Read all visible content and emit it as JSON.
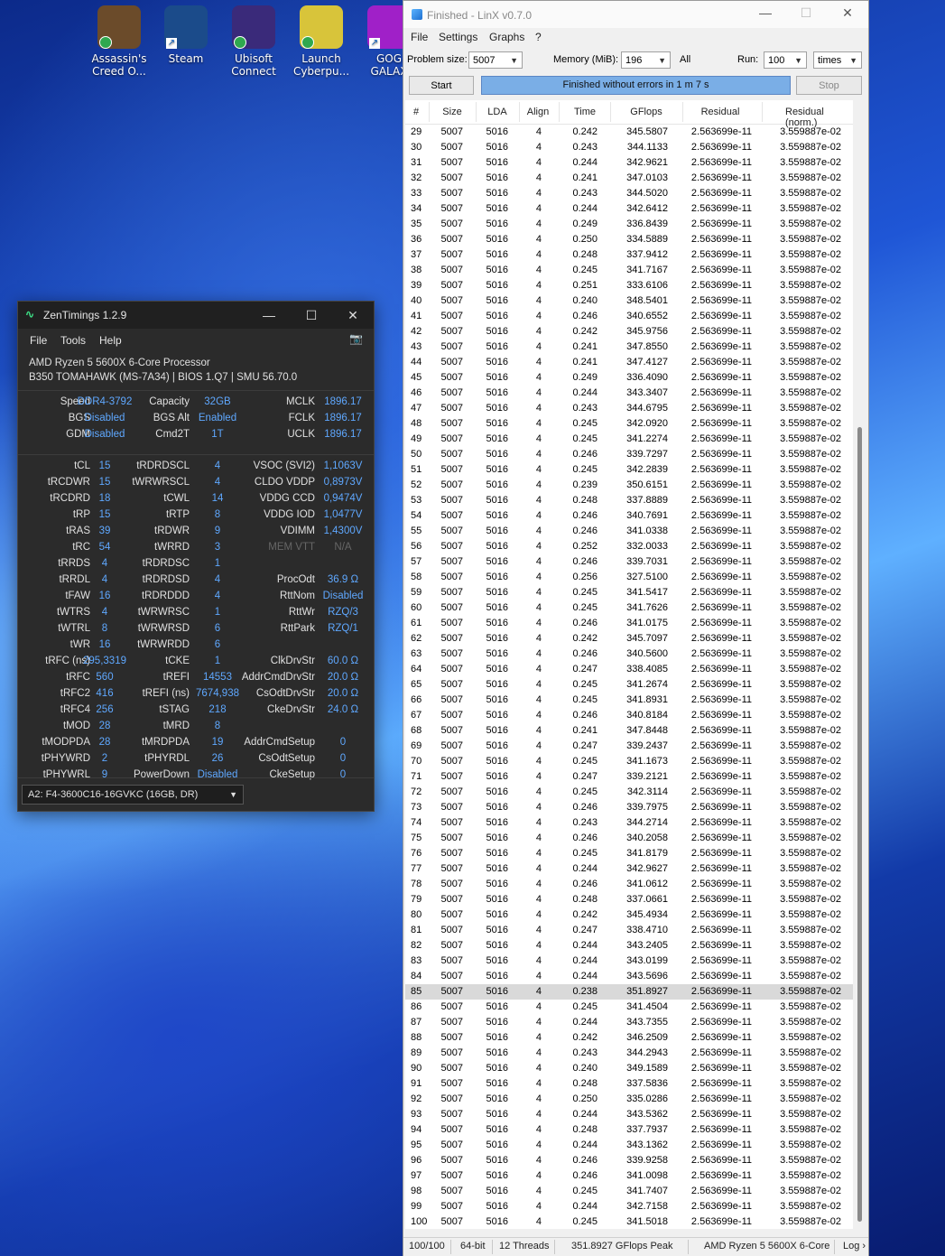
{
  "desktop": {
    "icons": [
      {
        "label": "Assassin's Creed O...",
        "color": "#6b4b2a",
        "badge": "check"
      },
      {
        "label": "Steam",
        "color": "#1b4b8a",
        "badge": "link"
      },
      {
        "label": "Ubisoft Connect",
        "color": "#3a2a7a",
        "badge": "check"
      },
      {
        "label": "Launch Cyberpu...",
        "color": "#d8c43a",
        "badge": "check"
      },
      {
        "label": "GOG GALAX",
        "color": "#a020c8",
        "badge": "link"
      }
    ]
  },
  "zentimings": {
    "title": "ZenTimings 1.2.9",
    "menu": [
      "File",
      "Tools",
      "Help"
    ],
    "cpu": "AMD Ryzen 5 5600X 6-Core Processor",
    "board": "B350 TOMAHAWK (MS-7A34) | BIOS 1.Q7 | SMU 56.70.0",
    "rows1": [
      [
        "Speed",
        "DDR4-3792",
        "Capacity",
        "32GB",
        "MCLK",
        "1896.17"
      ],
      [
        "BGS",
        "Disabled",
        "BGS Alt",
        "Enabled",
        "FCLK",
        "1896.17"
      ],
      [
        "GDM",
        "Disabled",
        "Cmd2T",
        "1T",
        "UCLK",
        "1896.17"
      ]
    ],
    "rows2": [
      [
        "tCL",
        "15",
        "tRDRDSCL",
        "4",
        "VSOC (SVI2)",
        "1,1063V"
      ],
      [
        "tRCDWR",
        "15",
        "tWRWRSCL",
        "4",
        "CLDO VDDP",
        "0,8973V"
      ],
      [
        "tRCDRD",
        "18",
        "tCWL",
        "14",
        "VDDG CCD",
        "0,9474V"
      ],
      [
        "tRP",
        "15",
        "tRTP",
        "8",
        "VDDG IOD",
        "1,0477V"
      ],
      [
        "tRAS",
        "39",
        "tRDWR",
        "9",
        "VDIMM",
        "1,4300V"
      ],
      [
        "tRC",
        "54",
        "tWRRD",
        "3",
        "MEM VTT",
        "N/A"
      ],
      [
        "tRRDS",
        "4",
        "tRDRDSC",
        "1",
        "",
        ""
      ],
      [
        "tRRDL",
        "4",
        "tRDRDSD",
        "4",
        "ProcOdt",
        "36.9 Ω"
      ],
      [
        "tFAW",
        "16",
        "tRDRDDD",
        "4",
        "RttNom",
        "Disabled"
      ],
      [
        "tWTRS",
        "4",
        "tWRWRSC",
        "1",
        "RttWr",
        "RZQ/3"
      ],
      [
        "tWTRL",
        "8",
        "tWRWRSD",
        "6",
        "RttPark",
        "RZQ/1"
      ],
      [
        "tWR",
        "16",
        "tWRWRDD",
        "6",
        "",
        ""
      ],
      [
        "tRFC (ns)",
        "295,3319",
        "tCKE",
        "1",
        "ClkDrvStr",
        "60.0 Ω"
      ],
      [
        "tRFC",
        "560",
        "tREFI",
        "14553",
        "AddrCmdDrvStr",
        "20.0 Ω"
      ],
      [
        "tRFC2",
        "416",
        "tREFI (ns)",
        "7674,938",
        "CsOdtDrvStr",
        "20.0 Ω"
      ],
      [
        "tRFC4",
        "256",
        "tSTAG",
        "218",
        "CkeDrvStr",
        "24.0 Ω"
      ],
      [
        "tMOD",
        "28",
        "tMRD",
        "8",
        "",
        ""
      ],
      [
        "tMODPDA",
        "28",
        "tMRDPDA",
        "19",
        "AddrCmdSetup",
        "0"
      ],
      [
        "tPHYWRD",
        "2",
        "tPHYRDL",
        "26",
        "CsOdtSetup",
        "0"
      ],
      [
        "tPHYWRL",
        "9",
        "PowerDown",
        "Disabled",
        "CkeSetup",
        "0"
      ]
    ],
    "module": "A2: F4-3600C16-16GVKC (16GB, DR)"
  },
  "linx": {
    "title": "Finished - LinX v0.7.0",
    "menu": [
      "File",
      "Settings",
      "Graphs",
      "?"
    ],
    "problem_size_label": "Problem size:",
    "problem_size": "5007",
    "memory_label": "Memory (MiB):",
    "memory": "196",
    "all_label": "All",
    "run_label": "Run:",
    "run": "100",
    "run_unit": "times",
    "start": "Start",
    "progress_text": "Finished without errors in 1 m 7 s",
    "progress_value": 1.0,
    "stop": "Stop",
    "columns": [
      "#",
      "Size",
      "LDA",
      "Align",
      "Time",
      "GFlops",
      "Residual",
      "Residual (norm.)"
    ],
    "rows": [
      [
        "29",
        "5007",
        "5016",
        "4",
        "0.242",
        "345.5807",
        "2.563699e-11",
        "3.559887e-02"
      ],
      [
        "30",
        "5007",
        "5016",
        "4",
        "0.243",
        "344.1133",
        "2.563699e-11",
        "3.559887e-02"
      ],
      [
        "31",
        "5007",
        "5016",
        "4",
        "0.244",
        "342.9621",
        "2.563699e-11",
        "3.559887e-02"
      ],
      [
        "32",
        "5007",
        "5016",
        "4",
        "0.241",
        "347.0103",
        "2.563699e-11",
        "3.559887e-02"
      ],
      [
        "33",
        "5007",
        "5016",
        "4",
        "0.243",
        "344.5020",
        "2.563699e-11",
        "3.559887e-02"
      ],
      [
        "34",
        "5007",
        "5016",
        "4",
        "0.244",
        "342.6412",
        "2.563699e-11",
        "3.559887e-02"
      ],
      [
        "35",
        "5007",
        "5016",
        "4",
        "0.249",
        "336.8439",
        "2.563699e-11",
        "3.559887e-02"
      ],
      [
        "36",
        "5007",
        "5016",
        "4",
        "0.250",
        "334.5889",
        "2.563699e-11",
        "3.559887e-02"
      ],
      [
        "37",
        "5007",
        "5016",
        "4",
        "0.248",
        "337.9412",
        "2.563699e-11",
        "3.559887e-02"
      ],
      [
        "38",
        "5007",
        "5016",
        "4",
        "0.245",
        "341.7167",
        "2.563699e-11",
        "3.559887e-02"
      ],
      [
        "39",
        "5007",
        "5016",
        "4",
        "0.251",
        "333.6106",
        "2.563699e-11",
        "3.559887e-02"
      ],
      [
        "40",
        "5007",
        "5016",
        "4",
        "0.240",
        "348.5401",
        "2.563699e-11",
        "3.559887e-02"
      ],
      [
        "41",
        "5007",
        "5016",
        "4",
        "0.246",
        "340.6552",
        "2.563699e-11",
        "3.559887e-02"
      ],
      [
        "42",
        "5007",
        "5016",
        "4",
        "0.242",
        "345.9756",
        "2.563699e-11",
        "3.559887e-02"
      ],
      [
        "43",
        "5007",
        "5016",
        "4",
        "0.241",
        "347.8550",
        "2.563699e-11",
        "3.559887e-02"
      ],
      [
        "44",
        "5007",
        "5016",
        "4",
        "0.241",
        "347.4127",
        "2.563699e-11",
        "3.559887e-02"
      ],
      [
        "45",
        "5007",
        "5016",
        "4",
        "0.249",
        "336.4090",
        "2.563699e-11",
        "3.559887e-02"
      ],
      [
        "46",
        "5007",
        "5016",
        "4",
        "0.244",
        "343.3407",
        "2.563699e-11",
        "3.559887e-02"
      ],
      [
        "47",
        "5007",
        "5016",
        "4",
        "0.243",
        "344.6795",
        "2.563699e-11",
        "3.559887e-02"
      ],
      [
        "48",
        "5007",
        "5016",
        "4",
        "0.245",
        "342.0920",
        "2.563699e-11",
        "3.559887e-02"
      ],
      [
        "49",
        "5007",
        "5016",
        "4",
        "0.245",
        "341.2274",
        "2.563699e-11",
        "3.559887e-02"
      ],
      [
        "50",
        "5007",
        "5016",
        "4",
        "0.246",
        "339.7297",
        "2.563699e-11",
        "3.559887e-02"
      ],
      [
        "51",
        "5007",
        "5016",
        "4",
        "0.245",
        "342.2839",
        "2.563699e-11",
        "3.559887e-02"
      ],
      [
        "52",
        "5007",
        "5016",
        "4",
        "0.239",
        "350.6151",
        "2.563699e-11",
        "3.559887e-02"
      ],
      [
        "53",
        "5007",
        "5016",
        "4",
        "0.248",
        "337.8889",
        "2.563699e-11",
        "3.559887e-02"
      ],
      [
        "54",
        "5007",
        "5016",
        "4",
        "0.246",
        "340.7691",
        "2.563699e-11",
        "3.559887e-02"
      ],
      [
        "55",
        "5007",
        "5016",
        "4",
        "0.246",
        "341.0338",
        "2.563699e-11",
        "3.559887e-02"
      ],
      [
        "56",
        "5007",
        "5016",
        "4",
        "0.252",
        "332.0033",
        "2.563699e-11",
        "3.559887e-02"
      ],
      [
        "57",
        "5007",
        "5016",
        "4",
        "0.246",
        "339.7031",
        "2.563699e-11",
        "3.559887e-02"
      ],
      [
        "58",
        "5007",
        "5016",
        "4",
        "0.256",
        "327.5100",
        "2.563699e-11",
        "3.559887e-02"
      ],
      [
        "59",
        "5007",
        "5016",
        "4",
        "0.245",
        "341.5417",
        "2.563699e-11",
        "3.559887e-02"
      ],
      [
        "60",
        "5007",
        "5016",
        "4",
        "0.245",
        "341.7626",
        "2.563699e-11",
        "3.559887e-02"
      ],
      [
        "61",
        "5007",
        "5016",
        "4",
        "0.246",
        "341.0175",
        "2.563699e-11",
        "3.559887e-02"
      ],
      [
        "62",
        "5007",
        "5016",
        "4",
        "0.242",
        "345.7097",
        "2.563699e-11",
        "3.559887e-02"
      ],
      [
        "63",
        "5007",
        "5016",
        "4",
        "0.246",
        "340.5600",
        "2.563699e-11",
        "3.559887e-02"
      ],
      [
        "64",
        "5007",
        "5016",
        "4",
        "0.247",
        "338.4085",
        "2.563699e-11",
        "3.559887e-02"
      ],
      [
        "65",
        "5007",
        "5016",
        "4",
        "0.245",
        "341.2674",
        "2.563699e-11",
        "3.559887e-02"
      ],
      [
        "66",
        "5007",
        "5016",
        "4",
        "0.245",
        "341.8931",
        "2.563699e-11",
        "3.559887e-02"
      ],
      [
        "67",
        "5007",
        "5016",
        "4",
        "0.246",
        "340.8184",
        "2.563699e-11",
        "3.559887e-02"
      ],
      [
        "68",
        "5007",
        "5016",
        "4",
        "0.241",
        "347.8448",
        "2.563699e-11",
        "3.559887e-02"
      ],
      [
        "69",
        "5007",
        "5016",
        "4",
        "0.247",
        "339.2437",
        "2.563699e-11",
        "3.559887e-02"
      ],
      [
        "70",
        "5007",
        "5016",
        "4",
        "0.245",
        "341.1673",
        "2.563699e-11",
        "3.559887e-02"
      ],
      [
        "71",
        "5007",
        "5016",
        "4",
        "0.247",
        "339.2121",
        "2.563699e-11",
        "3.559887e-02"
      ],
      [
        "72",
        "5007",
        "5016",
        "4",
        "0.245",
        "342.3114",
        "2.563699e-11",
        "3.559887e-02"
      ],
      [
        "73",
        "5007",
        "5016",
        "4",
        "0.246",
        "339.7975",
        "2.563699e-11",
        "3.559887e-02"
      ],
      [
        "74",
        "5007",
        "5016",
        "4",
        "0.243",
        "344.2714",
        "2.563699e-11",
        "3.559887e-02"
      ],
      [
        "75",
        "5007",
        "5016",
        "4",
        "0.246",
        "340.2058",
        "2.563699e-11",
        "3.559887e-02"
      ],
      [
        "76",
        "5007",
        "5016",
        "4",
        "0.245",
        "341.8179",
        "2.563699e-11",
        "3.559887e-02"
      ],
      [
        "77",
        "5007",
        "5016",
        "4",
        "0.244",
        "342.9627",
        "2.563699e-11",
        "3.559887e-02"
      ],
      [
        "78",
        "5007",
        "5016",
        "4",
        "0.246",
        "341.0612",
        "2.563699e-11",
        "3.559887e-02"
      ],
      [
        "79",
        "5007",
        "5016",
        "4",
        "0.248",
        "337.0661",
        "2.563699e-11",
        "3.559887e-02"
      ],
      [
        "80",
        "5007",
        "5016",
        "4",
        "0.242",
        "345.4934",
        "2.563699e-11",
        "3.559887e-02"
      ],
      [
        "81",
        "5007",
        "5016",
        "4",
        "0.247",
        "338.4710",
        "2.563699e-11",
        "3.559887e-02"
      ],
      [
        "82",
        "5007",
        "5016",
        "4",
        "0.244",
        "343.2405",
        "2.563699e-11",
        "3.559887e-02"
      ],
      [
        "83",
        "5007",
        "5016",
        "4",
        "0.244",
        "343.0199",
        "2.563699e-11",
        "3.559887e-02"
      ],
      [
        "84",
        "5007",
        "5016",
        "4",
        "0.244",
        "343.5696",
        "2.563699e-11",
        "3.559887e-02"
      ],
      [
        "85",
        "5007",
        "5016",
        "4",
        "0.238",
        "351.8927",
        "2.563699e-11",
        "3.559887e-02"
      ],
      [
        "86",
        "5007",
        "5016",
        "4",
        "0.245",
        "341.4504",
        "2.563699e-11",
        "3.559887e-02"
      ],
      [
        "87",
        "5007",
        "5016",
        "4",
        "0.244",
        "343.7355",
        "2.563699e-11",
        "3.559887e-02"
      ],
      [
        "88",
        "5007",
        "5016",
        "4",
        "0.242",
        "346.2509",
        "2.563699e-11",
        "3.559887e-02"
      ],
      [
        "89",
        "5007",
        "5016",
        "4",
        "0.243",
        "344.2943",
        "2.563699e-11",
        "3.559887e-02"
      ],
      [
        "90",
        "5007",
        "5016",
        "4",
        "0.240",
        "349.1589",
        "2.563699e-11",
        "3.559887e-02"
      ],
      [
        "91",
        "5007",
        "5016",
        "4",
        "0.248",
        "337.5836",
        "2.563699e-11",
        "3.559887e-02"
      ],
      [
        "92",
        "5007",
        "5016",
        "4",
        "0.250",
        "335.0286",
        "2.563699e-11",
        "3.559887e-02"
      ],
      [
        "93",
        "5007",
        "5016",
        "4",
        "0.244",
        "343.5362",
        "2.563699e-11",
        "3.559887e-02"
      ],
      [
        "94",
        "5007",
        "5016",
        "4",
        "0.248",
        "337.7937",
        "2.563699e-11",
        "3.559887e-02"
      ],
      [
        "95",
        "5007",
        "5016",
        "4",
        "0.244",
        "343.1362",
        "2.563699e-11",
        "3.559887e-02"
      ],
      [
        "96",
        "5007",
        "5016",
        "4",
        "0.246",
        "339.9258",
        "2.563699e-11",
        "3.559887e-02"
      ],
      [
        "97",
        "5007",
        "5016",
        "4",
        "0.246",
        "341.0098",
        "2.563699e-11",
        "3.559887e-02"
      ],
      [
        "98",
        "5007",
        "5016",
        "4",
        "0.245",
        "341.7407",
        "2.563699e-11",
        "3.559887e-02"
      ],
      [
        "99",
        "5007",
        "5016",
        "4",
        "0.244",
        "342.7158",
        "2.563699e-11",
        "3.559887e-02"
      ],
      [
        "100",
        "5007",
        "5016",
        "4",
        "0.245",
        "341.5018",
        "2.563699e-11",
        "3.559887e-02"
      ]
    ],
    "selected_row": "85",
    "status": {
      "progress": "100/100",
      "bits": "64-bit",
      "threads": "12 Threads",
      "peak": "351.8927 GFlops Peak",
      "cpu": "AMD Ryzen 5 5600X 6-Core",
      "log": "Log ›"
    }
  }
}
